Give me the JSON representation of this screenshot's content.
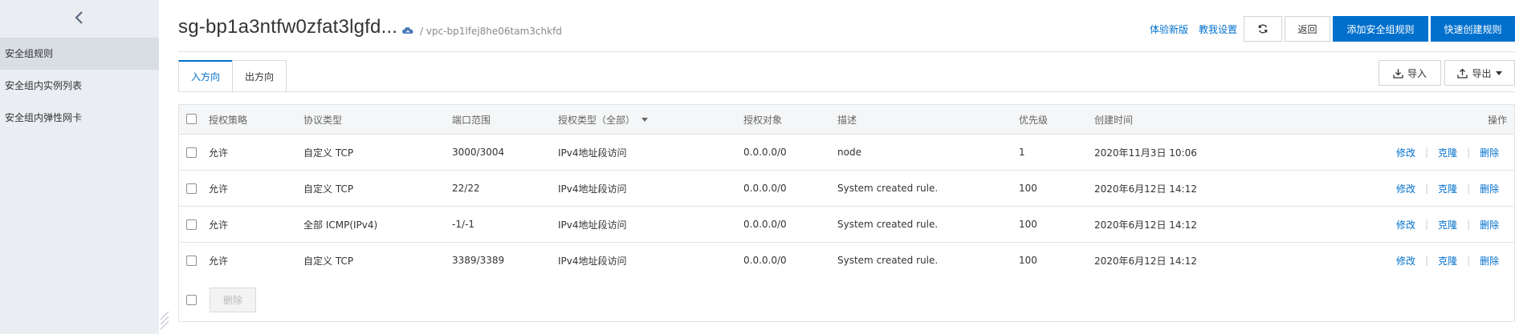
{
  "sidebar": {
    "items": [
      {
        "label": "安全组规则",
        "active": true
      },
      {
        "label": "安全组内实例列表",
        "active": false
      },
      {
        "label": "安全组内弹性网卡",
        "active": false
      }
    ]
  },
  "header": {
    "title": "sg-bp1a3ntfw0zfat3lgfd...",
    "vpc": "/ vpc-bp1lfej8he06tam3chkfd",
    "links": {
      "try_new": "体验新版",
      "teach_me": "教我设置"
    },
    "buttons": {
      "back": "返回",
      "add_rule": "添加安全组规则",
      "quick_create": "快速创建规则"
    }
  },
  "tabs": [
    {
      "label": "入方向",
      "active": true
    },
    {
      "label": "出方向",
      "active": false
    }
  ],
  "toolbar": {
    "import": "导入",
    "export": "导出"
  },
  "table": {
    "columns": [
      "授权策略",
      "协议类型",
      "端口范围",
      "授权类型（全部）",
      "授权对象",
      "描述",
      "优先级",
      "创建时间",
      "操作"
    ],
    "rows": [
      {
        "policy": "允许",
        "protocol": "自定义 TCP",
        "port": "3000/3004",
        "auth_type": "IPv4地址段访问",
        "target": "0.0.0.0/0",
        "desc": "node",
        "priority": "1",
        "created": "2020年11月3日 10:06"
      },
      {
        "policy": "允许",
        "protocol": "自定义 TCP",
        "port": "22/22",
        "auth_type": "IPv4地址段访问",
        "target": "0.0.0.0/0",
        "desc": "System created rule.",
        "priority": "100",
        "created": "2020年6月12日 14:12"
      },
      {
        "policy": "允许",
        "protocol": "全部 ICMP(IPv4)",
        "port": "-1/-1",
        "auth_type": "IPv4地址段访问",
        "target": "0.0.0.0/0",
        "desc": "System created rule.",
        "priority": "100",
        "created": "2020年6月12日 14:12"
      },
      {
        "policy": "允许",
        "protocol": "自定义 TCP",
        "port": "3389/3389",
        "auth_type": "IPv4地址段访问",
        "target": "0.0.0.0/0",
        "desc": "System created rule.",
        "priority": "100",
        "created": "2020年6月12日 14:12"
      }
    ],
    "actions": {
      "edit": "修改",
      "clone": "克隆",
      "delete": "删除"
    }
  },
  "footer": {
    "delete": "删除"
  },
  "colors": {
    "accent": "#0070cc",
    "sidebar_bg": "#eaedf1",
    "sidebar_active": "#d9dee4"
  }
}
